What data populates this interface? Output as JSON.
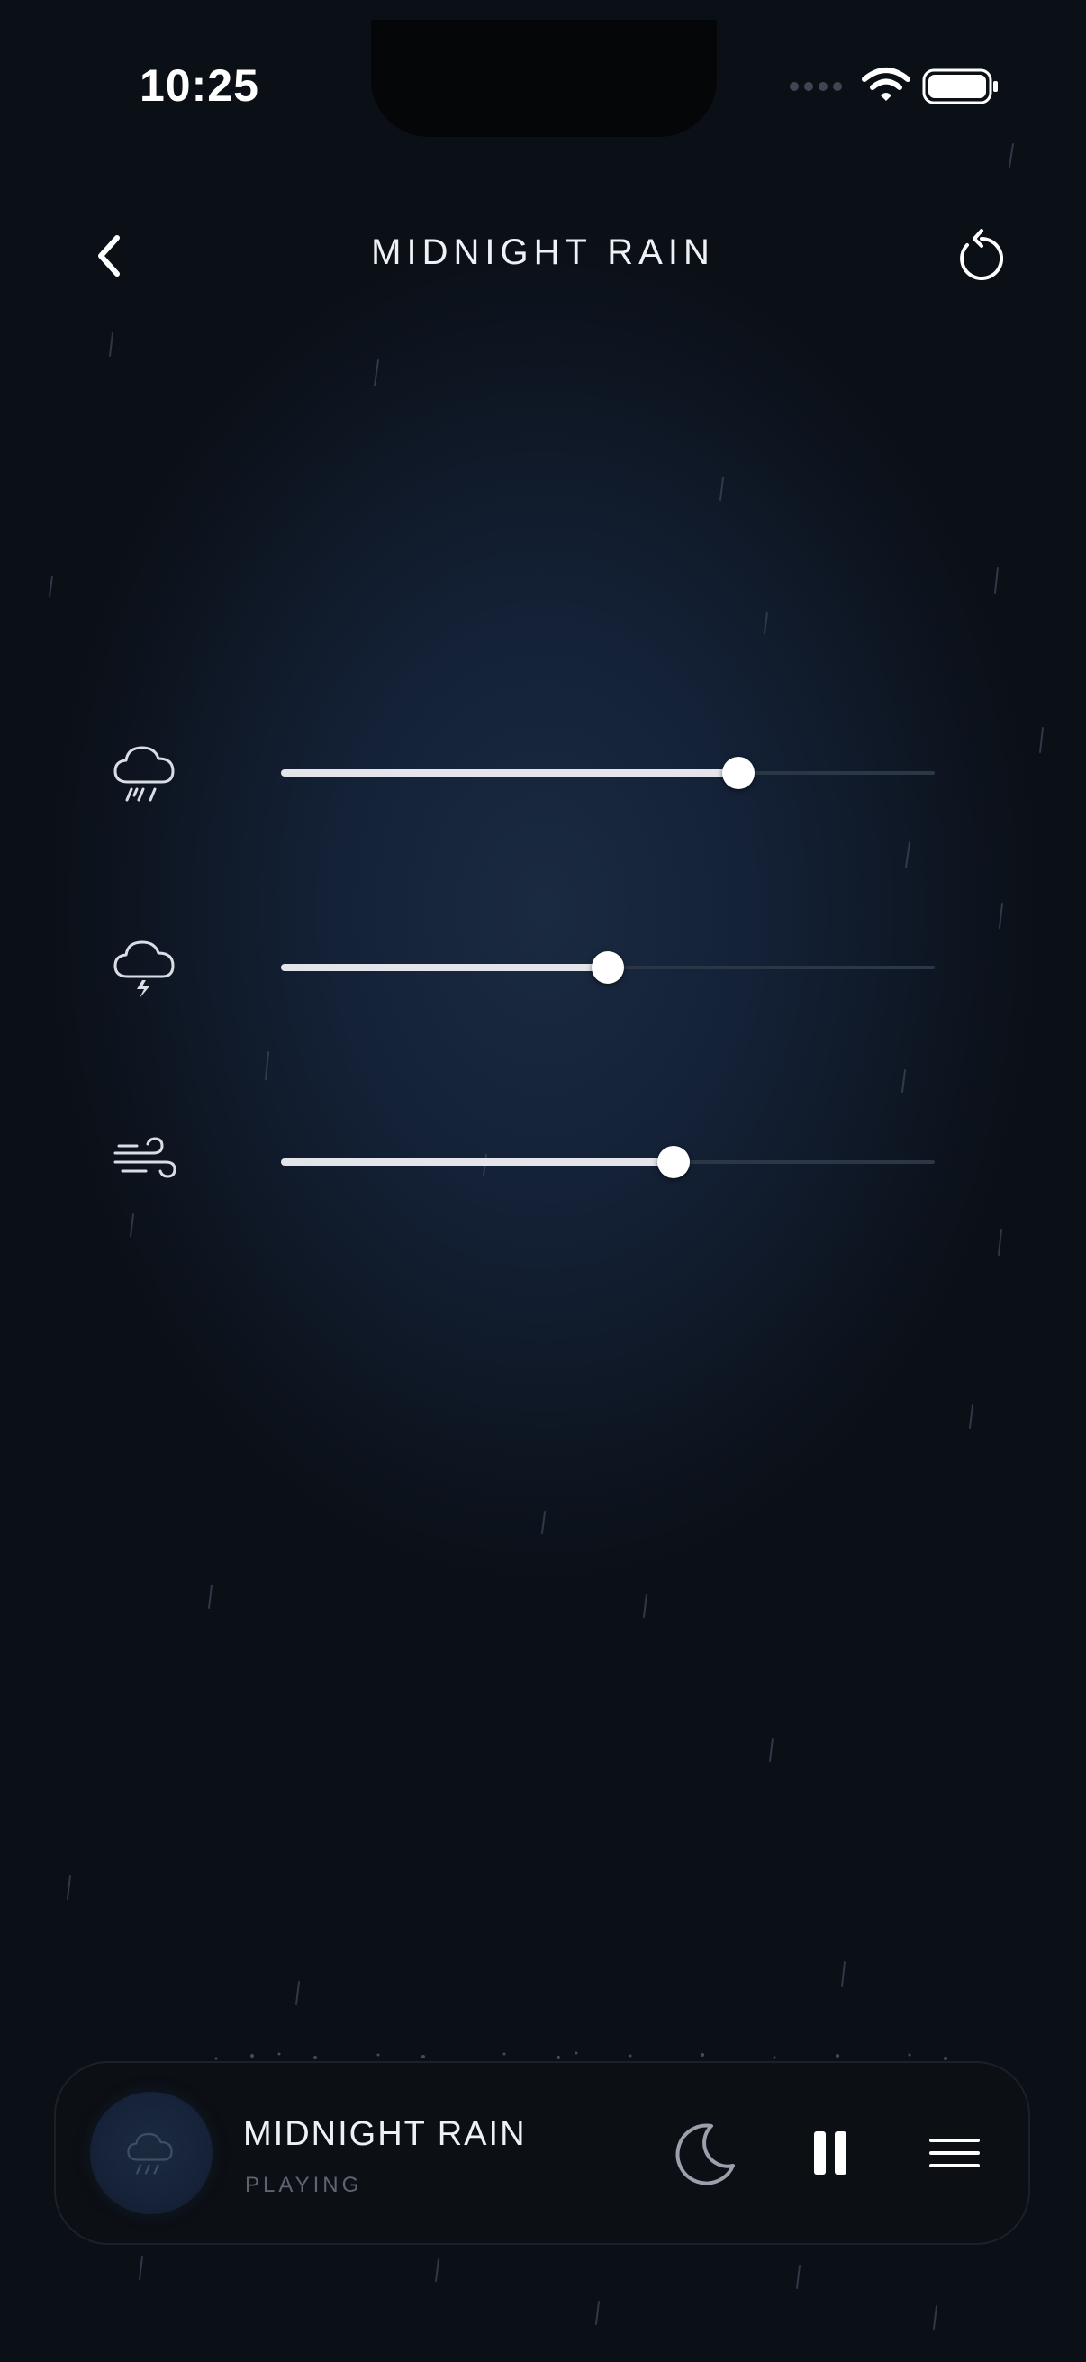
{
  "status_bar": {
    "time": "10:25"
  },
  "header": {
    "title": "MIDNIGHT RAIN",
    "back_icon": "chevron-left-icon",
    "reset_icon": "refresh-icon"
  },
  "mixer": [
    {
      "icon": "cloud-rain-icon",
      "level": 0.7
    },
    {
      "icon": "cloud-lightning-icon",
      "level": 0.5
    },
    {
      "icon": "wind-icon",
      "level": 0.6
    }
  ],
  "player": {
    "title": "MIDNIGHT RAIN",
    "status": "PLAYING",
    "art_icon": "cloud-rain-icon",
    "buttons": [
      "moon-icon",
      "pause-icon",
      "menu-icon"
    ]
  },
  "colors": {
    "background": "#0a0c10",
    "glow": "#1a2a40",
    "slider_fill": "#e3e5ea",
    "slider_track": "#2b3646",
    "muted_text": "#5d6573"
  }
}
